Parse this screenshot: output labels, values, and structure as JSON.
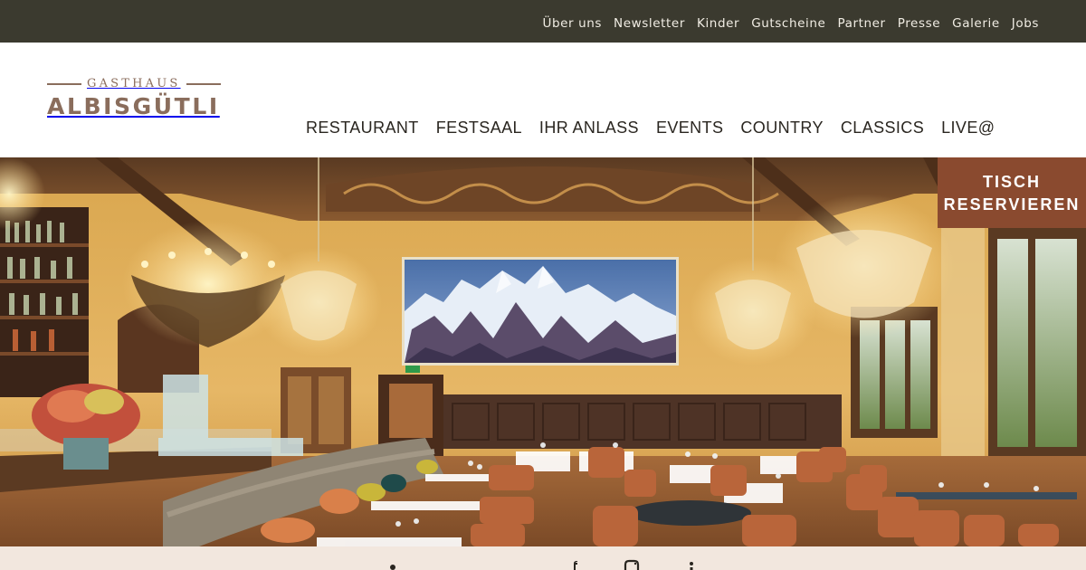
{
  "topnav": {
    "items": [
      "Über uns",
      "Newsletter",
      "Kinder",
      "Gutscheine",
      "Partner",
      "Presse",
      "Galerie",
      "Jobs"
    ]
  },
  "logo": {
    "subtitle": "GASTHAUS",
    "name": "ALBISGÜTLI"
  },
  "mainnav": {
    "items": [
      "RESTAURANT",
      "FESTSAAL",
      "IHR ANLASS",
      "EVENTS",
      "COUNTRY",
      "CLASSICS",
      "LIVE@"
    ]
  },
  "hero": {
    "image": "restaurant-dining-hall-photo"
  },
  "reserve_button": {
    "line1": "TISCH",
    "line2": "RESERVIEREN"
  },
  "social": {
    "icons": [
      "tripadvisor-icon",
      "facebook-icon",
      "instagram-icon",
      "linkedin-icon"
    ]
  },
  "colors": {
    "topbar_bg": "#3b3a2f",
    "brand": "#8a6d5c",
    "reserve_bg": "#8a4a2f",
    "footer_bg": "#f2e7de"
  }
}
